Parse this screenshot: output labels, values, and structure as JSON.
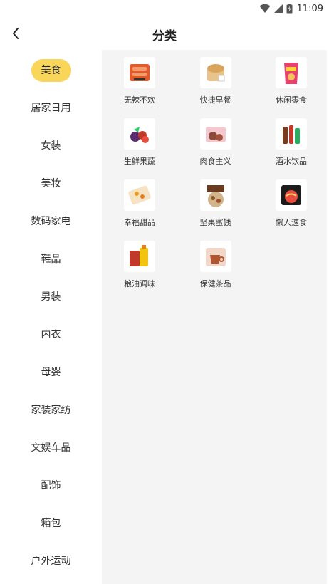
{
  "status_bar": {
    "time": "11:09"
  },
  "header": {
    "title": "分类"
  },
  "sidebar": {
    "active_index": 0,
    "items": [
      {
        "label": "美食"
      },
      {
        "label": "居家日用"
      },
      {
        "label": "女装"
      },
      {
        "label": "美妆"
      },
      {
        "label": "数码家电"
      },
      {
        "label": "鞋品"
      },
      {
        "label": "男装"
      },
      {
        "label": "内衣"
      },
      {
        "label": "母婴"
      },
      {
        "label": "家装家纺"
      },
      {
        "label": "文娱车品"
      },
      {
        "label": "配饰"
      },
      {
        "label": "箱包"
      },
      {
        "label": "户外运动"
      }
    ]
  },
  "categories": [
    {
      "label": "无辣不欢",
      "icon": "sausage-icon"
    },
    {
      "label": "快捷早餐",
      "icon": "bread-icon"
    },
    {
      "label": "休闲零食",
      "icon": "chips-icon"
    },
    {
      "label": "生鲜果蔬",
      "icon": "fruit-icon"
    },
    {
      "label": "肉食主义",
      "icon": "meat-icon"
    },
    {
      "label": "酒水饮品",
      "icon": "drinks-icon"
    },
    {
      "label": "幸福甜品",
      "icon": "dessert-icon"
    },
    {
      "label": "坚果蜜饯",
      "icon": "nuts-icon"
    },
    {
      "label": "懒人速食",
      "icon": "noodles-icon"
    },
    {
      "label": "粮油调味",
      "icon": "oil-icon"
    },
    {
      "label": "保健茶品",
      "icon": "tea-icon"
    }
  ],
  "colors": {
    "active_pill": "#f9d55a",
    "content_bg": "#f4f4f4"
  }
}
